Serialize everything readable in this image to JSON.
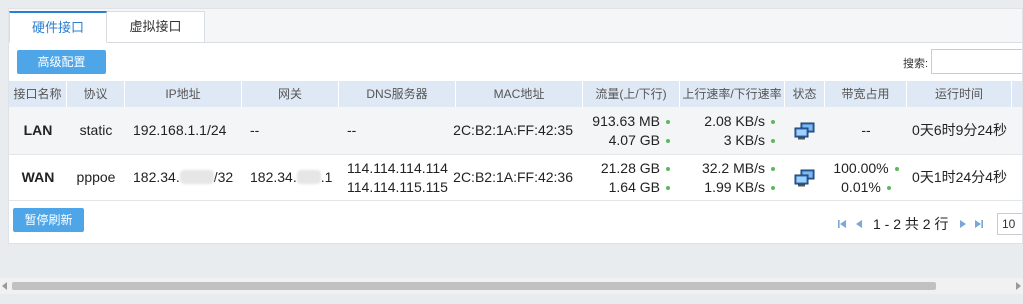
{
  "tabs": [
    {
      "label": "硬件接口",
      "active": true
    },
    {
      "label": "虚拟接口",
      "active": false
    }
  ],
  "toolbar": {
    "advanced_label": "高级配置",
    "search_label": "搜索:",
    "search_value": "",
    "pause_label": "暂停刷新"
  },
  "table": {
    "headers": [
      "接口名称",
      "协议",
      "IP地址",
      "网关",
      "DNS服务器",
      "MAC地址",
      "流量(上/下行)",
      "上行速率/下行速率",
      "状态",
      "带宽占用",
      "运行时间"
    ],
    "rows": [
      {
        "name": "LAN",
        "protocol": "static",
        "ip_prefix": "192.168.1.1/24",
        "ip_suffix": "",
        "gateway_prefix": "--",
        "gateway_suffix": "",
        "dns": [
          "--",
          ""
        ],
        "mac": "2C:B2:1A:FF:42:35",
        "traffic_up": "913.63 MB",
        "traffic_down": "4.07 GB",
        "rate_up": "2.08 KB/s",
        "rate_down": "3 KB/s",
        "bandwidth_up": "--",
        "bandwidth_down": "",
        "uptime": "0天6时9分24秒"
      },
      {
        "name": "WAN",
        "protocol": "pppoe",
        "ip_prefix": "182.34.",
        "ip_suffix": "/32",
        "gateway_prefix": "182.34.",
        "gateway_suffix": ".1",
        "dns": [
          "114.114.114.114",
          "114.114.115.115"
        ],
        "mac": "2C:B2:1A:FF:42:36",
        "traffic_up": "21.28 GB",
        "traffic_down": "1.64 GB",
        "rate_up": "32.2 MB/s",
        "rate_down": "1.99 KB/s",
        "bandwidth_up": "100.00%",
        "bandwidth_down": "0.01%",
        "uptime": "0天1时24分4秒"
      }
    ]
  },
  "pagination": {
    "summary": "1 - 2 共 2 行",
    "page_size": "10"
  },
  "colors": {
    "accent": "#2b7fd2",
    "button": "#4ea6e8",
    "header_bg": "#dfe9f5",
    "ok_dot": "#5cb85c"
  }
}
